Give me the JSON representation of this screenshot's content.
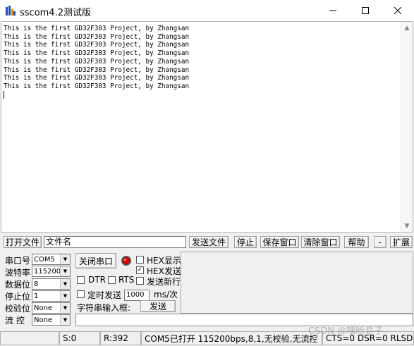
{
  "window": {
    "title": "sscom4.2测试版",
    "minimize": "minimize",
    "maximize": "maximize",
    "close": "close"
  },
  "receive": {
    "lines": [
      "This is the first GD32F303 Project, by Zhangsan",
      "This is the first GD32F303 Project, by Zhangsan",
      "This is the first GD32F303 Project, by Zhangsan",
      "This is the first GD32F303 Project, by Zhangsan",
      "This is the first GD32F303 Project, by Zhangsan",
      "This is the first GD32F303 Project, by Zhangsan",
      "This is the first GD32F303 Project, by Zhangsan",
      "This is the first GD32F303 Project, by Zhangsan"
    ]
  },
  "toolbar": {
    "open_file": "打开文件",
    "filename_value": "文件名",
    "send_file": "发送文件",
    "stop": "停止",
    "save_window": "保存窗口",
    "clear_window": "清除窗口",
    "help": "帮助",
    "minus": "-",
    "expand": "扩展"
  },
  "settings": {
    "port_label": "串口号",
    "port_value": "COM5",
    "baud_label": "波特率",
    "baud_value": "115200",
    "databits_label": "数据位",
    "databits_value": "8",
    "stopbits_label": "停止位",
    "stopbits_value": "1",
    "parity_label": "校验位",
    "parity_value": "None",
    "flow_label": "流 控",
    "flow_value": "None"
  },
  "controls": {
    "close_port": "关闭串口",
    "hex_display": "HEX显示",
    "hex_display_checked": false,
    "hex_send": "HEX发送",
    "hex_send_checked": true,
    "dtr": "DTR",
    "rts": "RTS",
    "send_newline": "发送新行",
    "timed_send": "定时发送",
    "interval_value": "1000",
    "interval_unit": "ms/次",
    "string_input_label": "字符串输入框:",
    "send": "发送"
  },
  "status": {
    "sent": "S:0",
    "received": "R:392",
    "port_info": "COM5已打开  115200bps,8,1,无校验,无流控",
    "lines": "CTS=0 DSR=0 RLSD",
    "watermark": "CSDN @嘿哈皂子"
  },
  "colors": {
    "indicator": "#cc0000",
    "accent_icon": "#1a4fb5"
  }
}
